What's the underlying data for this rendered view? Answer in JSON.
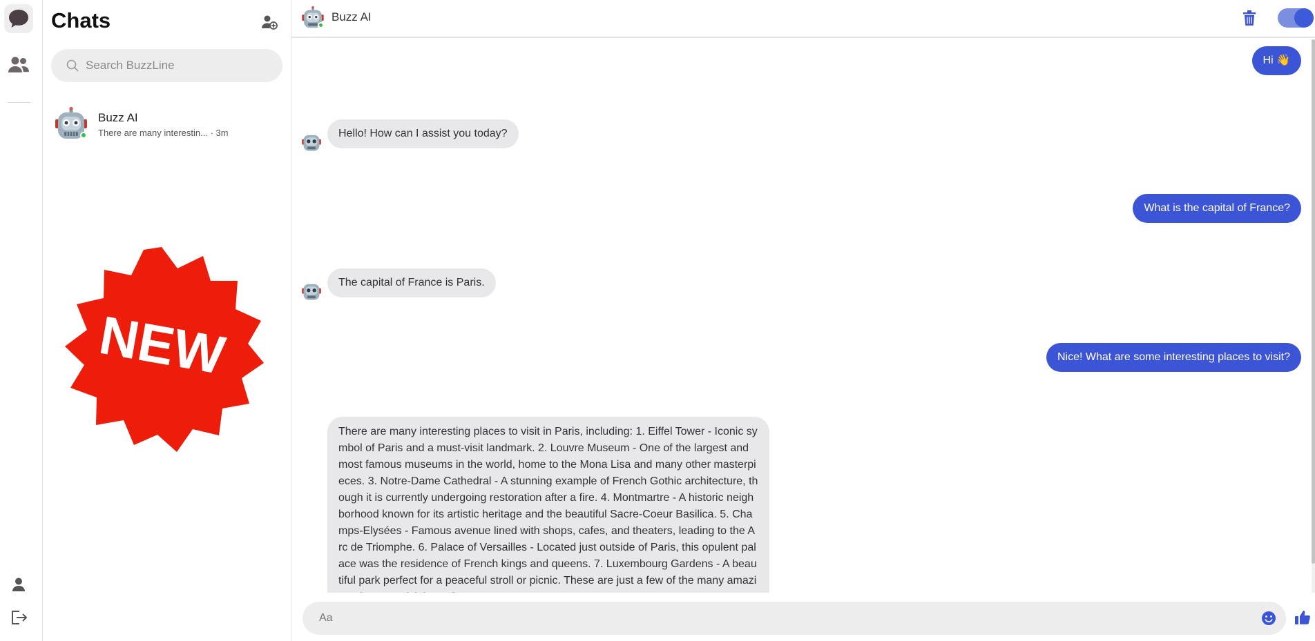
{
  "rail": {
    "items": [
      {
        "name": "chats",
        "icon": "chat-bubble-icon",
        "active": true
      },
      {
        "name": "people",
        "icon": "people-icon",
        "active": false
      }
    ],
    "bottom": [
      {
        "name": "profile",
        "icon": "person-icon"
      },
      {
        "name": "logout",
        "icon": "logout-icon"
      }
    ]
  },
  "sidebar": {
    "title": "Chats",
    "add_contact_icon": "add-contact-icon",
    "search": {
      "placeholder": "Search BuzzLine",
      "value": ""
    },
    "chats": [
      {
        "name": "Buzz AI",
        "preview": "There are many interestin... · 3m",
        "online": true
      }
    ],
    "badge_text": "NEW"
  },
  "conversation": {
    "header": {
      "name": "Buzz AI",
      "online": true,
      "trash_icon": "trash-icon",
      "toggle_on": true
    },
    "messages": [
      {
        "from": "me",
        "text": "Hi 👋"
      },
      {
        "from": "bot",
        "text": "Hello! How can I assist you today?"
      },
      {
        "from": "me",
        "text": "What is the capital of France?"
      },
      {
        "from": "bot",
        "text": "The capital of France is Paris."
      },
      {
        "from": "me",
        "text": "Nice! What are some interesting places to visit?"
      },
      {
        "from": "bot",
        "text": "There are many interesting places to visit in Paris, including: 1. Eiffel Tower - Iconic symbol of Paris and a must-visit landmark. 2. Louvre Museum - One of the largest and most famous museums in the world, home to the Mona Lisa and many other masterpieces. 3. Notre-Dame Cathedral - A stunning example of French Gothic architecture, though it is currently undergoing restoration after a fire. 4. Montmartre - A historic neighborhood known for its artistic heritage and the beautiful Sacre-Coeur Basilica. 5. Champs-Elysées - Famous avenue lined with shops, cafes, and theaters, leading to the Arc de Triomphe. 6. Palace of Versailles - Located just outside of Paris, this opulent palace was the residence of French kings and queens. 7. Luxembourg Gardens - A beautiful park perfect for a peaceful stroll or picnic. These are just a few of the many amazing places to visit in Paris!"
      }
    ],
    "composer": {
      "placeholder": "Aa",
      "value": "",
      "emoji_icon": "smiley-icon",
      "like_icon": "thumbs-up-icon"
    }
  },
  "colors": {
    "accent": "#3b55d6",
    "bubble_in": "#e8e7ea",
    "online": "#31c24a",
    "badge": "#ee1c0a"
  }
}
